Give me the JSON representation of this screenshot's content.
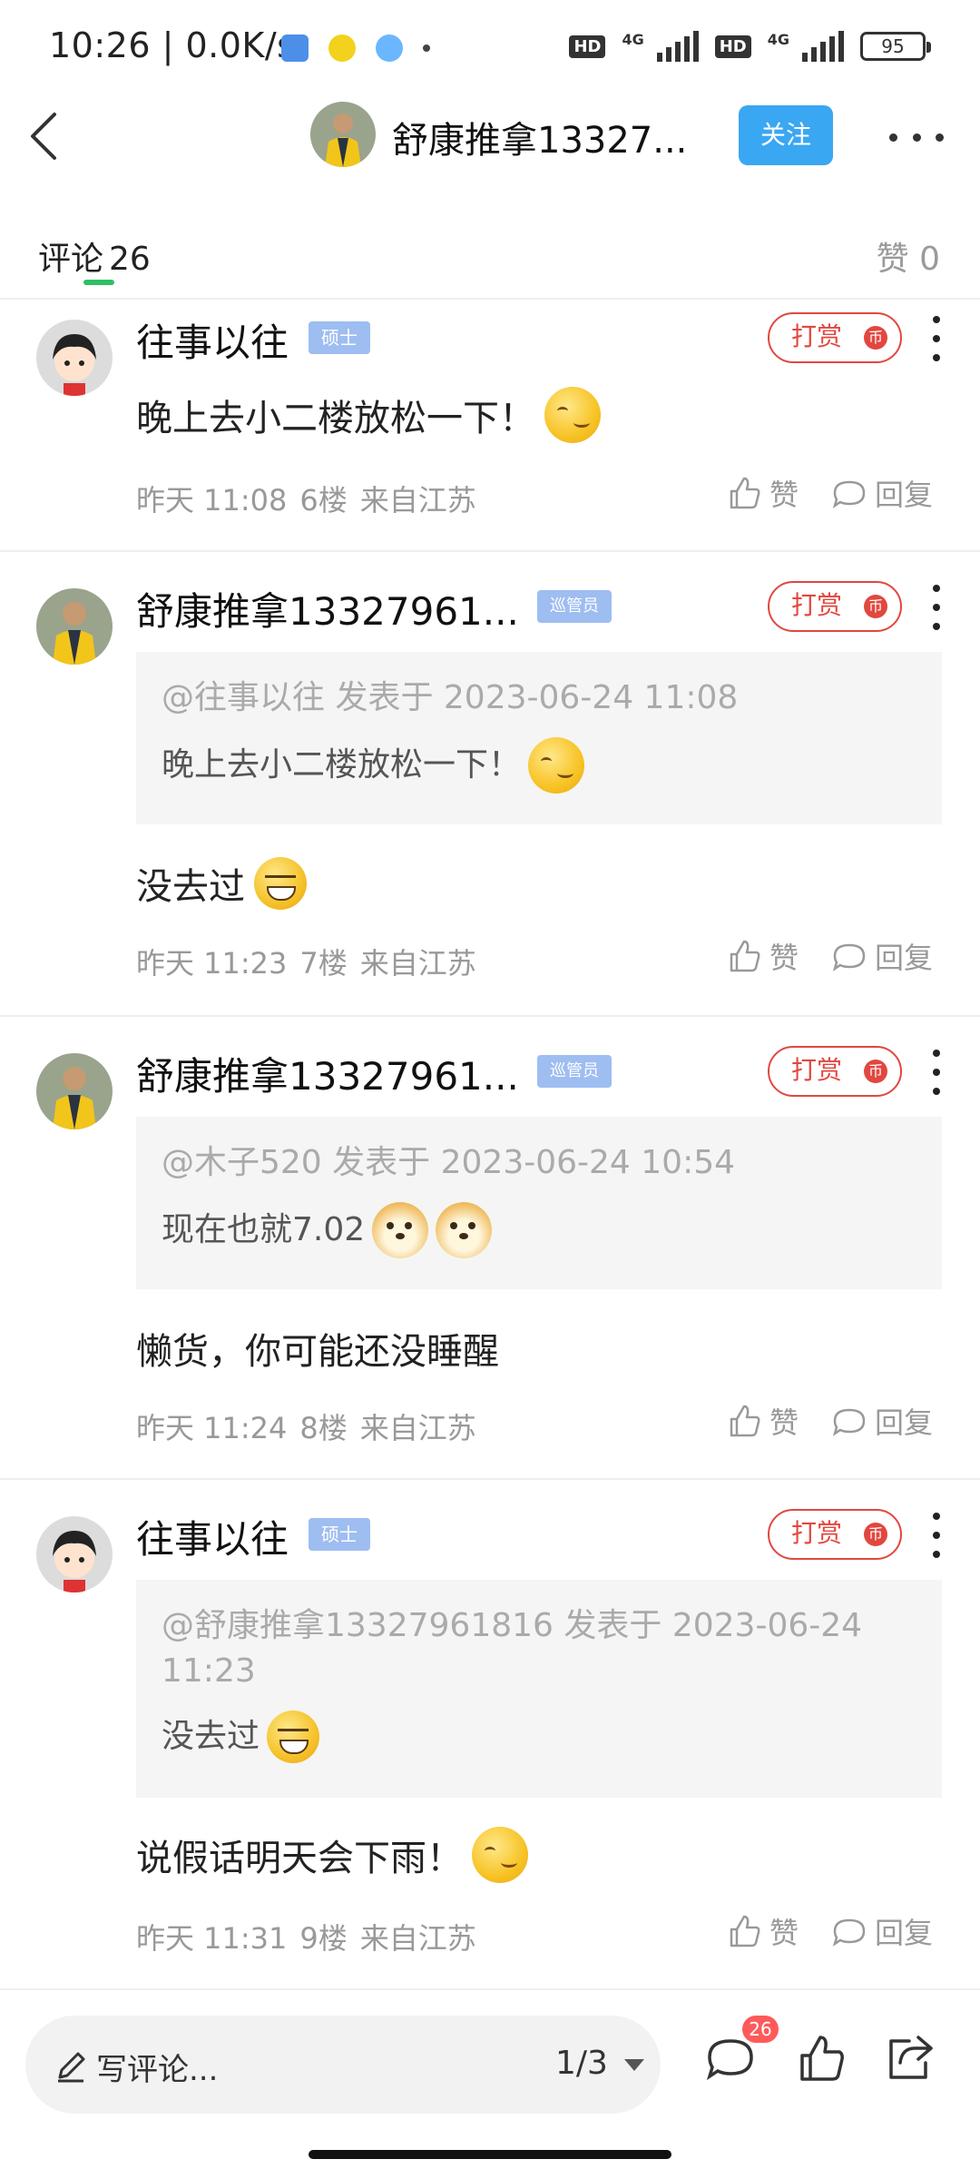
{
  "status_bar": {
    "time_speed": "10:26 | 0.0K/s",
    "hd1": "HD",
    "net1": "4G",
    "hd2": "HD",
    "net2": "4G",
    "battery": "95"
  },
  "header": {
    "username": "舒康推拿13327...",
    "follow_label": "关注"
  },
  "tabs": {
    "comments_label": "评论",
    "comments_count": "26",
    "likes_label": "赞 0"
  },
  "comments": [
    {
      "username": "往事以往",
      "badge": "硕士",
      "tip_label": "打赏",
      "coin": "币",
      "text": "晚上去小二楼放松一下！",
      "time": "昨天 11:08",
      "floor": "6楼",
      "location": "来自江苏",
      "like_label": "赞",
      "reply_label": "回复"
    },
    {
      "username": "舒康推拿13327961...",
      "badge": "巡管员",
      "tip_label": "打赏",
      "coin": "币",
      "quote_meta": "@往事以往 发表于 2023-06-24 11:08",
      "quote_text": "晚上去小二楼放松一下！",
      "text": "没去过",
      "time": "昨天 11:23",
      "floor": "7楼",
      "location": "来自江苏",
      "like_label": "赞",
      "reply_label": "回复"
    },
    {
      "username": "舒康推拿13327961...",
      "badge": "巡管员",
      "tip_label": "打赏",
      "coin": "币",
      "quote_meta": "@木子520 发表于 2023-06-24 10:54",
      "quote_text": "现在也就7.02",
      "text": "懒货，你可能还没睡醒",
      "time": "昨天 11:24",
      "floor": "8楼",
      "location": "来自江苏",
      "like_label": "赞",
      "reply_label": "回复"
    },
    {
      "username": "往事以往",
      "badge": "硕士",
      "tip_label": "打赏",
      "coin": "币",
      "quote_meta": "@舒康推拿13327961816 发表于 2023-06-24 11:23",
      "quote_text": "没去过",
      "text": "说假话明天会下雨！",
      "time": "昨天 11:31",
      "floor": "9楼",
      "location": "来自江苏",
      "like_label": "赞",
      "reply_label": "回复"
    }
  ],
  "bottom_bar": {
    "placeholder": "写评论...",
    "pager": "1/3",
    "comment_badge": "26"
  },
  "colors": {
    "accent_blue": "#3aa7f2",
    "tip_red": "#e2473f",
    "tab_green": "#2fbf63",
    "badge_blue": "#9ebdf1"
  }
}
